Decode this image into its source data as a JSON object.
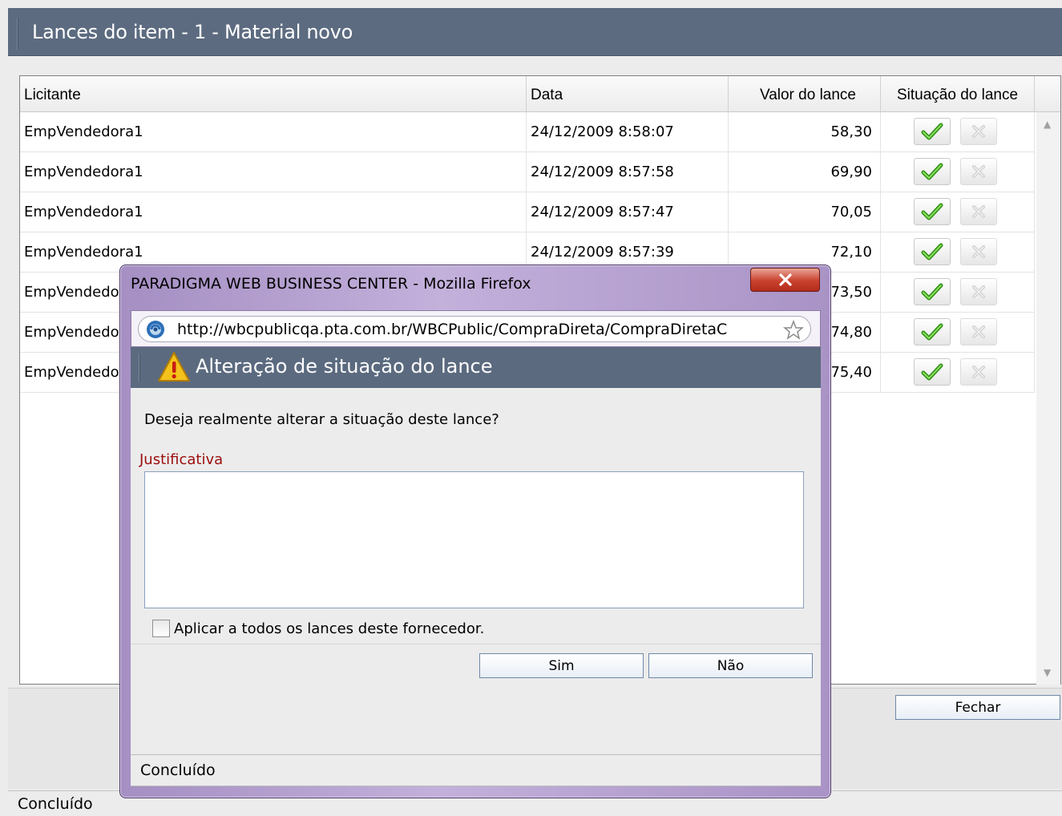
{
  "page": {
    "title": "Lances do item - 1 - Material novo"
  },
  "grid": {
    "columns": [
      "Licitante",
      "Data",
      "Valor do lance",
      "Situação do lance"
    ],
    "rows": [
      {
        "licitante": "EmpVendedora1",
        "data": "24/12/2009 8:58:07",
        "valor": "58,30"
      },
      {
        "licitante": "EmpVendedora1",
        "data": "24/12/2009 8:57:58",
        "valor": "69,90"
      },
      {
        "licitante": "EmpVendedora1",
        "data": "24/12/2009 8:57:47",
        "valor": "70,05"
      },
      {
        "licitante": "EmpVendedora1",
        "data": "24/12/2009 8:57:39",
        "valor": "72,10"
      },
      {
        "licitante": "EmpVendedor",
        "data": "",
        "valor": "73,50"
      },
      {
        "licitante": "EmpVendedor",
        "data": "",
        "valor": "74,80"
      },
      {
        "licitante": "EmpVendedor",
        "data": "",
        "valor": "75,40"
      }
    ],
    "accept_icon": "check-icon",
    "reject_icon": "x-icon"
  },
  "buttons": {
    "fechar": "Fechar"
  },
  "status": {
    "main": "Concluído"
  },
  "popup": {
    "window_title": "PARADIGMA WEB BUSINESS CENTER - Mozilla Firefox",
    "close_icon": "close-icon",
    "url": "http://wbcpublicqa.pta.com.br/WBCPublic/CompraDireta/CompraDiretaC",
    "dialog_title": "Alteração de situação do lance",
    "question": "Deseja realmente alterar a situação deste lance?",
    "justificativa_label": "Justificativa",
    "justificativa_value": "",
    "apply_all_label": "Aplicar a todos os lances deste fornecedor.",
    "apply_all_checked": false,
    "btn_sim": "Sim",
    "btn_nao": "Não",
    "status": "Concluído"
  },
  "colors": {
    "header_bg": "#5c6b80",
    "popup_frame": "#b7a3cf",
    "close_red": "#c9412e",
    "justificativa_red": "#9b0d0d",
    "check_green": "#3ea81f"
  }
}
